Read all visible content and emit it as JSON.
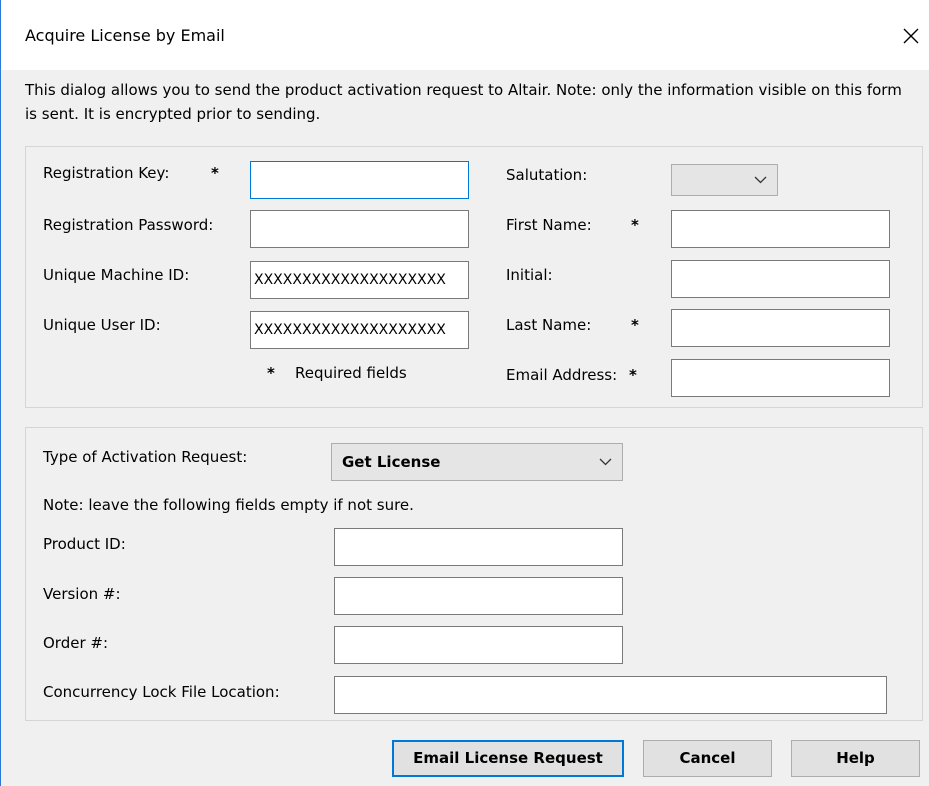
{
  "window": {
    "title": "Acquire License by Email"
  },
  "description": "This dialog allows you to send the product activation request to Altair. Note: only the information visible on this form is sent. It is encrypted prior to sending.",
  "registration": {
    "key_label": "Registration Key:",
    "key_value": "",
    "password_label": "Registration Password:",
    "password_value": "",
    "machine_id_label": "Unique Machine ID:",
    "machine_id_value": "XXXXXXXXXXXXXXXXXXXX",
    "user_id_label": "Unique User ID:",
    "user_id_value": "XXXXXXXXXXXXXXXXXXXX",
    "required_note": "Required fields",
    "required_star": "*"
  },
  "personal": {
    "salutation_label": "Salutation:",
    "salutation_value": "",
    "first_name_label": "First Name:",
    "first_name_value": "",
    "initial_label": "Initial:",
    "initial_value": "",
    "last_name_label": "Last Name:",
    "last_name_value": "",
    "email_label": "Email Address:",
    "email_value": ""
  },
  "activation": {
    "type_label": "Type of Activation Request:",
    "type_value": "Get License",
    "note": "Note: leave the following fields empty if not sure.",
    "product_id_label": "Product ID:",
    "product_id_value": "",
    "version_label": "Version #:",
    "version_value": "",
    "order_label": "Order #:",
    "order_value": "",
    "lock_file_label": "Concurrency Lock File Location:",
    "lock_file_value": ""
  },
  "buttons": {
    "email_request": "Email License Request",
    "cancel": "Cancel",
    "help": "Help"
  },
  "icons": {
    "close": "close-icon",
    "dropdown": "chevron-down-icon"
  },
  "colors": {
    "accent": "#0078d7",
    "window_border": "#2b79d6",
    "dialog_bg": "#f0f0f0"
  }
}
